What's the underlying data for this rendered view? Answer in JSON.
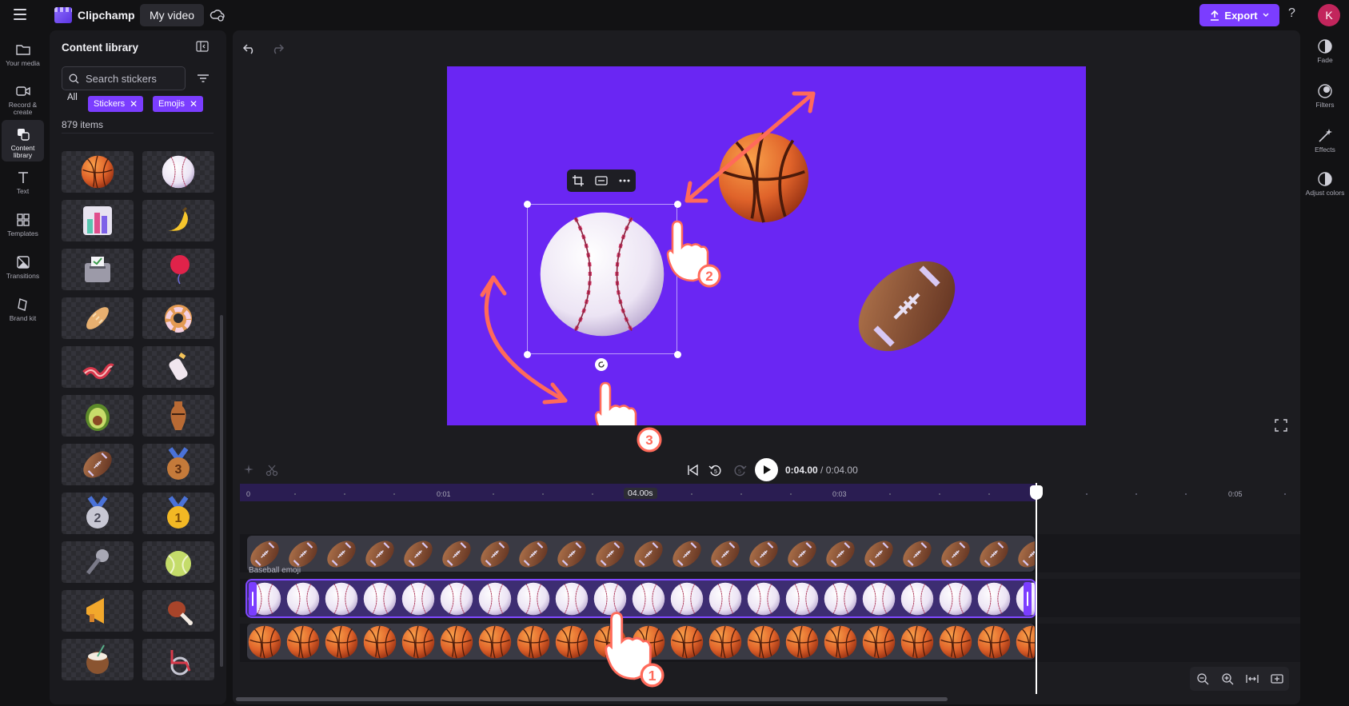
{
  "app": {
    "name": "Clipchamp",
    "project_name": "My video",
    "avatar_initial": "K",
    "accent": "#7b3dff"
  },
  "topbar": {
    "export_label": "Export",
    "help_label": "?"
  },
  "leftnav": [
    {
      "label": "Your media",
      "icon": "folder-icon"
    },
    {
      "label": "Record & create",
      "icon": "camera-icon"
    },
    {
      "label": "Content library",
      "icon": "library-icon",
      "active": true
    },
    {
      "label": "Text",
      "icon": "text-icon"
    },
    {
      "label": "Templates",
      "icon": "templates-icon"
    },
    {
      "label": "Transitions",
      "icon": "transitions-icon"
    },
    {
      "label": "Brand kit",
      "icon": "brand-kit-icon"
    }
  ],
  "library": {
    "title": "Content library",
    "search_placeholder": "Search stickers",
    "filter_all": "All",
    "chips": [
      "Stickers",
      "Emojis"
    ],
    "item_count": "879 items",
    "items": [
      "basketball",
      "baseball",
      "bar-chart",
      "banana",
      "ballot-box",
      "balloon",
      "baguette",
      "bagel",
      "bacon",
      "baby-bottle",
      "avocado",
      "amphora",
      "american-football",
      "3rd-place-medal",
      "2nd-place-medal",
      "1st-place-medal",
      "microphone",
      "tennis-ball",
      "loudspeaker",
      "meat-on-bone",
      "coconut-drink",
      "wheelchair"
    ]
  },
  "rightnav": [
    {
      "label": "Fade",
      "icon": "fade-icon"
    },
    {
      "label": "Filters",
      "icon": "filters-icon"
    },
    {
      "label": "Effects",
      "icon": "effects-icon"
    },
    {
      "label": "Adjust colors",
      "icon": "adjust-colors-icon"
    }
  ],
  "canvas": {
    "background": "#6a26f3",
    "stickers": [
      "baseball",
      "basketball",
      "american-football"
    ],
    "callout_numbers": [
      "1",
      "2",
      "3"
    ]
  },
  "playback": {
    "current_time": "0:04.00",
    "total_time": " / 0:04.00"
  },
  "timeline": {
    "ruler_labels": [
      "0",
      "0:01",
      "0:03",
      "0:05"
    ],
    "playhead_tooltip": "04.00s",
    "tracks": [
      {
        "name": "American football",
        "sticker": "american-football"
      },
      {
        "name": "Baseball emoji",
        "sticker": "baseball",
        "selected": true
      },
      {
        "name": "Basketball",
        "sticker": "basketball"
      }
    ],
    "selected_label": "Baseball emoji"
  }
}
